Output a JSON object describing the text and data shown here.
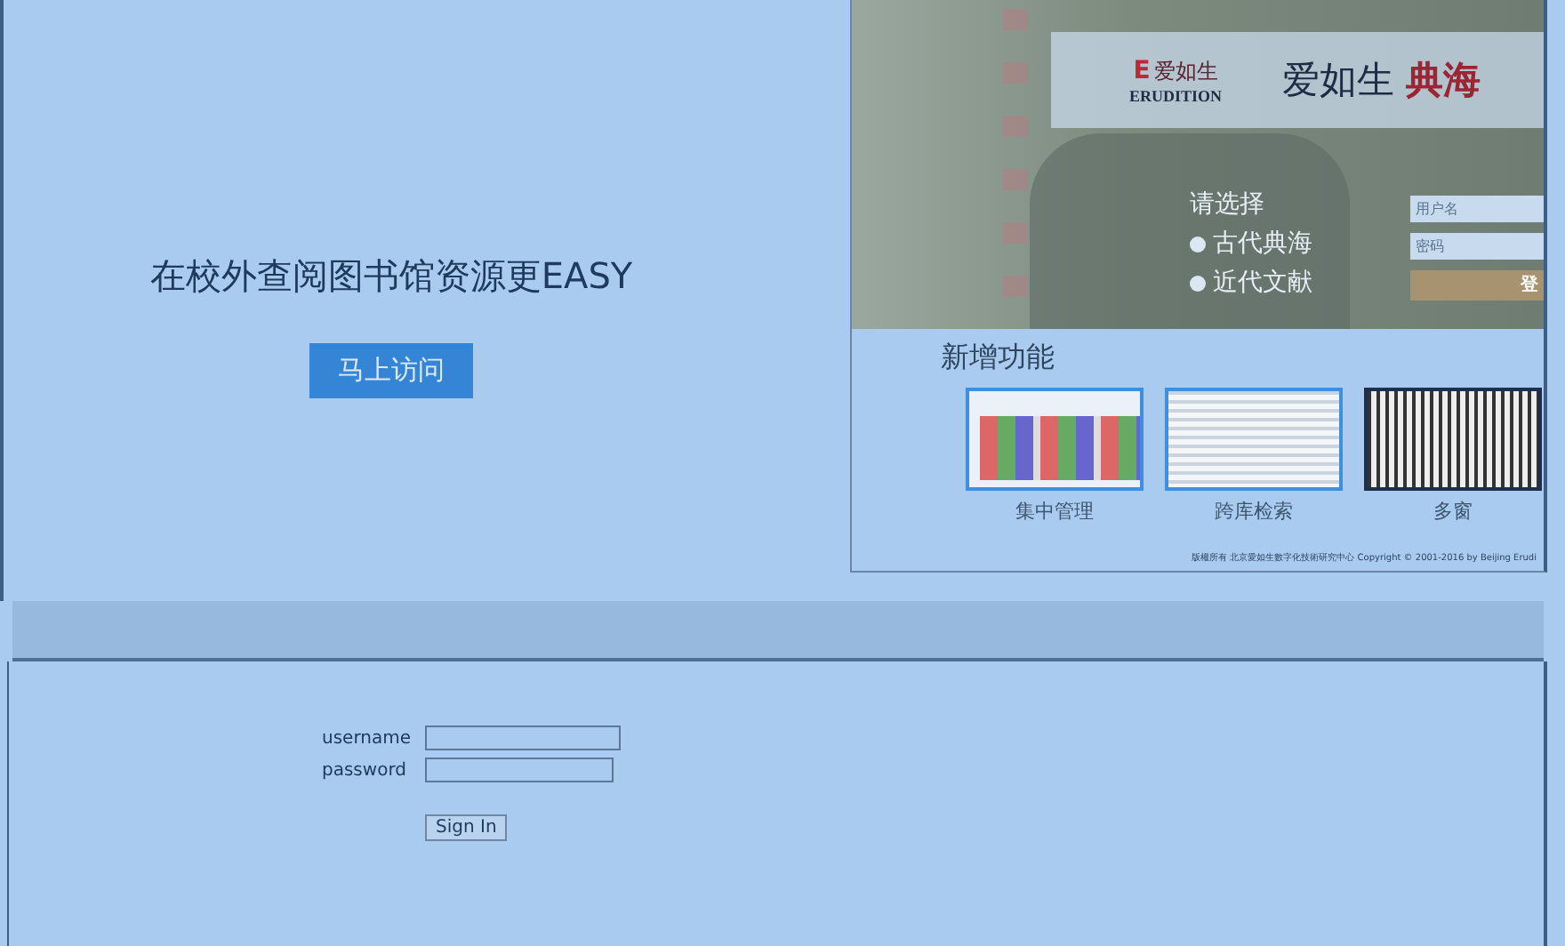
{
  "promo": {
    "headline": "在校外查阅图书馆资源更EASY",
    "button": "马上访问"
  },
  "preview": {
    "logo_mark": "E",
    "logo_name": "爱如生",
    "logo_latin": "ERUDITION",
    "site_title": "爱如生",
    "site_title_accent": "典海",
    "choose_label": "请选择",
    "options": [
      {
        "label": "古代典海"
      },
      {
        "label": "近代文献"
      }
    ],
    "username_placeholder": "用户名",
    "password_placeholder": "密码",
    "login_button": "登",
    "features_title": "新增功能",
    "features": [
      {
        "caption": "集中管理"
      },
      {
        "caption": "跨库检索"
      },
      {
        "caption": "多窗"
      }
    ],
    "footer": "版權所有 北京愛如生數字化技術研究中心 Copyright © 2001-2016 by Beijing Erudi"
  },
  "login": {
    "username_label": "username",
    "password_label": "password",
    "button": "Sign In"
  }
}
